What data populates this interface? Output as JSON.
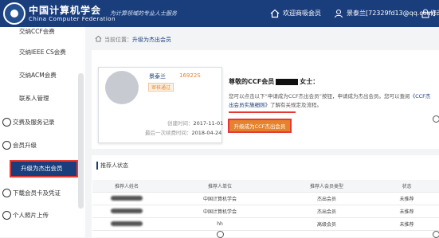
{
  "header": {
    "brand_cn": "中国计算机学会",
    "brand_en": "China Computer Federation",
    "slogan": "为计算领域的专业人士服务",
    "welcome": "欢迎商吸会员",
    "username": "景泰兰[72329fd13@qq.com]",
    "change_password": "修改密"
  },
  "sidebar": {
    "items": [
      {
        "label": "交纳CCF会费"
      },
      {
        "label": "交纳IEEE CS会费"
      },
      {
        "label": "交纳ACM会费"
      },
      {
        "label": "联系人管理"
      },
      {
        "label": "交费及服务记录"
      },
      {
        "label": "会员升级"
      },
      {
        "label": "升级为杰出会员"
      },
      {
        "label": "下载会员卡及凭证"
      },
      {
        "label": "个人照片上传"
      }
    ]
  },
  "breadcrumb": {
    "prefix": "当前位置：",
    "current": "升级为杰出会员"
  },
  "card": {
    "name": "景泰兰",
    "number": "16922S",
    "status": "审核通过",
    "create_label": "创建时间：",
    "create_value": "2017-11-01",
    "payment_label": "最后一次续费时间：",
    "payment_value": "2018-04-24"
  },
  "notice": {
    "greeting_pre": "尊敬的CCF会员",
    "greeting_post": "女士：",
    "line1": "您可以点击以下“申请成为CCF杰出会员”按钮，申请成为杰出会员。您可以查阅",
    "link": "《CCF杰出会员实施细则》",
    "line2": "了解有关规定及流程。",
    "button": "升级成为CCF杰出会员"
  },
  "recommenders": {
    "title": "推荐人状态",
    "columns": [
      "推荐人姓名",
      "推荐人单位",
      "推荐人会员类型",
      "状态"
    ],
    "rows": [
      {
        "unit": "中国计算机学会",
        "type": "杰出会员",
        "status": "未推荐"
      },
      {
        "unit": "中国计算机学会",
        "type": "杰出会员",
        "status": "未推荐"
      },
      {
        "unit": "hh",
        "type": "高级会员",
        "status": "未推荐"
      }
    ]
  }
}
